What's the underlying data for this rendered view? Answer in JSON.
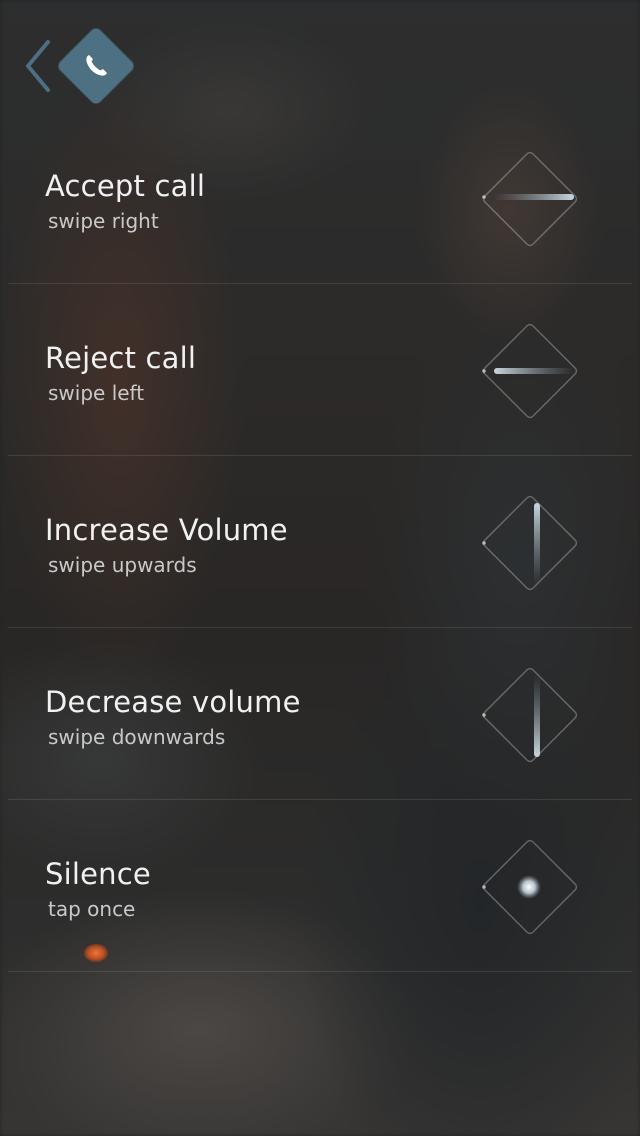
{
  "header": {
    "back_icon": "chevron-left-icon",
    "app_icon": "phone-icon",
    "accent_color": "#4d7183"
  },
  "gestures": [
    {
      "title": "Accept call",
      "subtitle": "swipe right",
      "icon": "swipe-right-gesture-icon"
    },
    {
      "title": "Reject call",
      "subtitle": "swipe left",
      "icon": "swipe-left-gesture-icon"
    },
    {
      "title": "Increase Volume",
      "subtitle": "swipe upwards",
      "icon": "swipe-up-gesture-icon"
    },
    {
      "title": "Decrease volume",
      "subtitle": "swipe downwards",
      "icon": "swipe-down-gesture-icon"
    },
    {
      "title": "Silence",
      "subtitle": "tap once",
      "icon": "tap-gesture-icon"
    }
  ]
}
